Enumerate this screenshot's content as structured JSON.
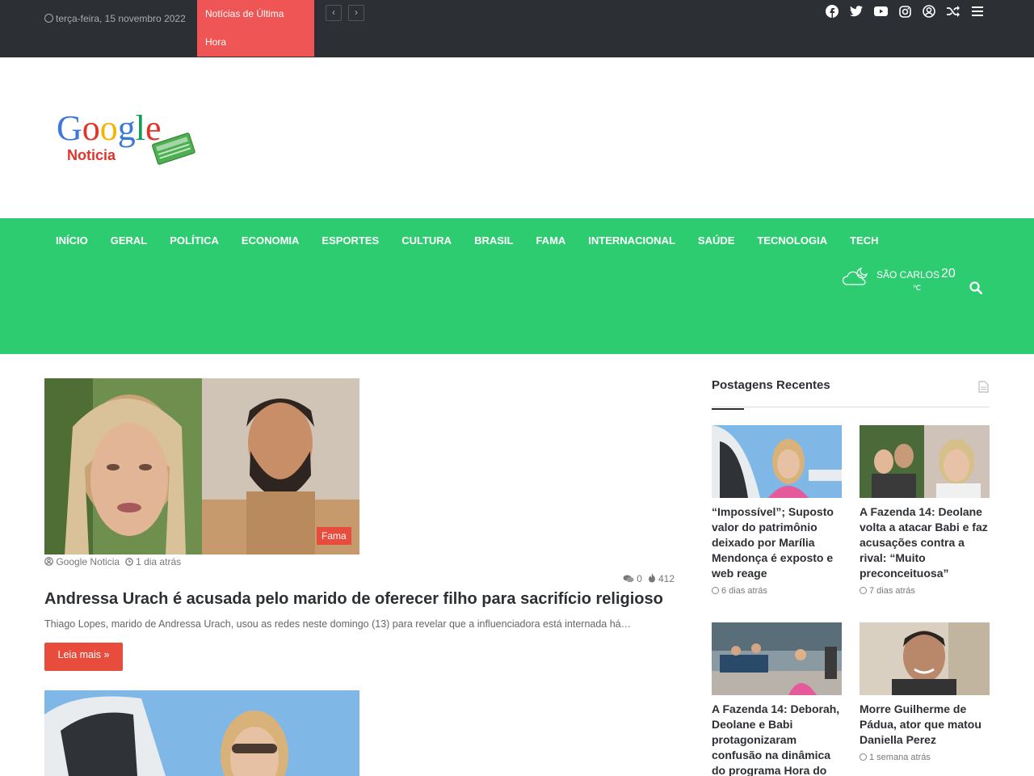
{
  "topbar": {
    "date": "terça-feira, 15 novembro 2022",
    "breaking_label": "Notícias de Última Hora",
    "prev_icon": "‹",
    "next_icon": "›",
    "social_icons": [
      "facebook-icon",
      "twitter-icon",
      "youtube-icon",
      "instagram-icon",
      "user-icon",
      "random-icon",
      "menu-icon"
    ]
  },
  "header": {
    "logo_text": "Google",
    "logo_sub": "Noticia",
    "logo_badge": "NEWS"
  },
  "nav": {
    "items": [
      "INÍCIO",
      "GERAL",
      "POLÍTICA",
      "ECONOMIA",
      "ESPORTES",
      "CULTURA",
      "BRASIL",
      "FAMA",
      "INTERNACIONAL",
      "SAÚDE",
      "TECNOLOGIA",
      "TECH"
    ],
    "weather_city": "SÃO CARLOS",
    "weather_temp": "20",
    "weather_unit": "℃"
  },
  "post": {
    "category": "Fama",
    "author": "Google Noticia",
    "time": "1 dia atrás",
    "comments": "0",
    "views": "412",
    "title": "Andressa Urach é acusada pelo marido de oferecer filho para sacrifício religioso",
    "excerpt": "Thiago Lopes, marido de Andressa Urach, usou as redes neste domingo (13) para revelar que a influenciadora está internada há…",
    "read_more": "Leia mais »"
  },
  "sidebar": {
    "title": "Postagens Recentes",
    "cards": [
      {
        "title": "“Impossível”; Suposto valor do patrimônio deixado por Marília Mendonça é exposto e web reage",
        "time": "6 dias atrás"
      },
      {
        "title": "A Fazenda 14: Deolane volta a atacar Babi e faz acusações contra a rival: “Muito preconceituosa”",
        "time": "7 dias atrás"
      },
      {
        "title": "A Fazenda 14: Deborah, Deolane e Babi protagonizaram confusão na dinâmica do programa Hora do",
        "time": ""
      },
      {
        "title": "Morre Guilherme de Pádua, ator que matou Daniella Perez",
        "time": "1 semana atrás"
      }
    ]
  },
  "colors": {
    "topbar": "#2c2f34",
    "accent_red": "#f05555",
    "nav_green": "#2ecc71",
    "button_red": "#e74c3c"
  }
}
